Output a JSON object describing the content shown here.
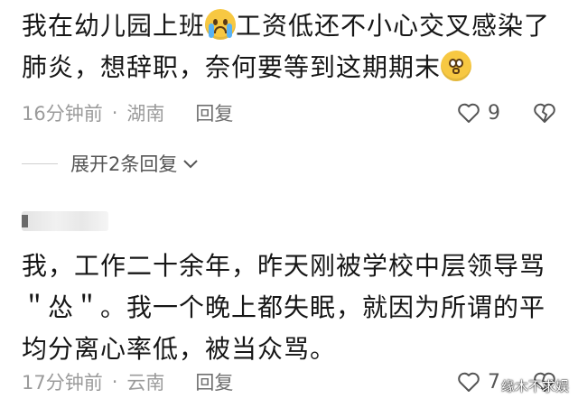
{
  "comment1": {
    "text_before": "我在幼儿园上班",
    "emoji_crying": "crying-face-emoji",
    "text_middle": "工资低还不小心交叉感染了肺炎，想辞职，奈何要等到这期期末",
    "emoji_pleading": "pleading-face-emoji",
    "time": "16分钟前",
    "location": "湖南",
    "reply_label": "回复",
    "like_count": "9"
  },
  "expand": {
    "label": "展开2条回复"
  },
  "comment2": {
    "text": "我，工作二十余年，昨天刚被学校中层领导骂＂怂＂。我一个晚上都失眠，就因为所谓的平均分离心率低，被当众骂。",
    "time": "17分钟前",
    "location": "云南",
    "reply_label": "回复",
    "like_count": "7"
  },
  "watermark": "缘木不求娱",
  "colors": {
    "text": "#161616",
    "meta": "#9b9b9b",
    "background": "#ffffff"
  }
}
